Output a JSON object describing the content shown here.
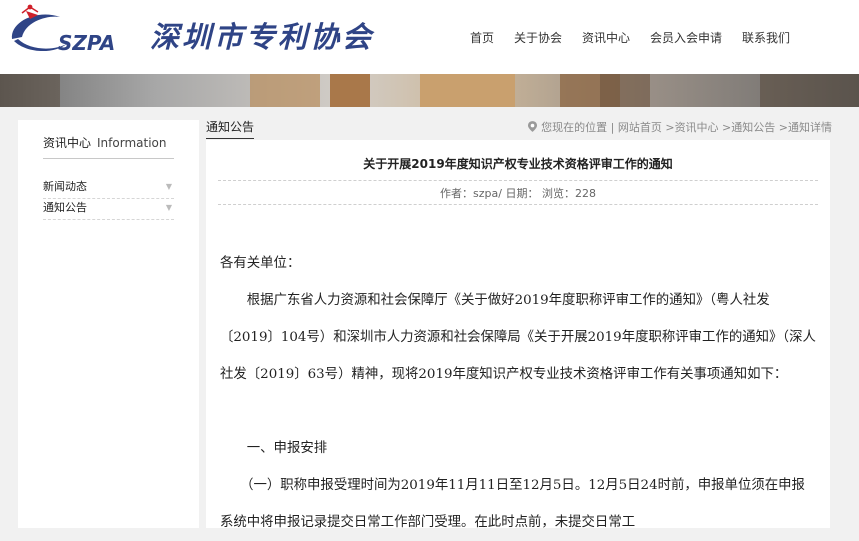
{
  "header": {
    "logo_text": "SZPA",
    "site_name": "深圳市专利协会",
    "nav": [
      "首页",
      "关于协会",
      "资讯中心",
      "会员入会申请",
      "联系我们"
    ]
  },
  "sidebar": {
    "title_cn": "资讯中心",
    "title_en": "Information",
    "items": [
      {
        "label": "新闻动态"
      },
      {
        "label": "通知公告"
      }
    ]
  },
  "breadcrumb": {
    "section_tab": "通知公告",
    "prefix": "您现在的位置",
    "items": [
      "网站首页",
      "资讯中心",
      "通知公告",
      "通知详情"
    ]
  },
  "article": {
    "title": "关于开展2019年度知识产权专业技术资格评审工作的通知",
    "meta": "作者：szpa/ 日期： 浏览：228",
    "paragraphs": [
      "各有关单位：",
      "　　根据广东省人力资源和社会保障厅《关于做好2019年度职称评审工作的通知》（粤人社发〔2019〕104号）和深圳市人力资源和社会保障局《关于开展2019年度职称评审工作的通知》（深人社发〔2019〕63号）精神，现将2019年度知识产权专业技术资格评审工作有关事项通知如下：",
      "　　一、申报安排",
      "　　（一）职称申报受理时间为2019年11月11日至12月5日。12月5日24时前，申报单位须在申报系统中将申报记录提交日常工作部门受理。在此时点前，未提交日常工"
    ]
  },
  "colors": {
    "brand_blue": "#2f4486",
    "logo_red": "#d0202a"
  }
}
